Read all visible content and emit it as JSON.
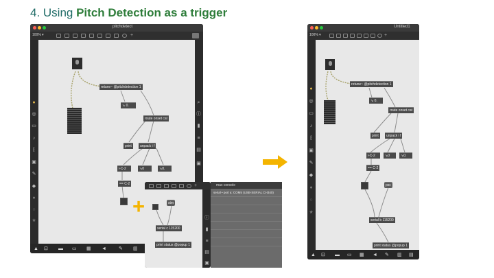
{
  "slide": {
    "title_prefix": "4. Using ",
    "title_bold": "Pitch Detection as a trigger"
  },
  "colors": {
    "title": "#1f6b66",
    "arrow": "#f4b400",
    "plus": "#f4b400",
    "patch_cable": "#a8a26a"
  },
  "window_left": {
    "title": "pitchdetect",
    "zoom": "100% ▾",
    "objects": {
      "retune": "retune~ @pitchdetection 1",
      "float_out": "↘ 0.",
      "route": "route onset cat",
      "print": "print",
      "unpack": "unpack i f",
      "note_name": "i-C-2",
      "num_a": "↘0",
      "num_b": "↘0.",
      "eq": "== C-2"
    },
    "icons": [
      "lock-icon",
      "presentation-icon",
      "grid-icon",
      "patcher-icon",
      "speaker-icon",
      "wrench-icon",
      "piano-icon"
    ]
  },
  "window_small": {
    "objects": {
      "msg": "stm",
      "serial": "serial c 115200",
      "print_status": "print status @popup 1"
    }
  },
  "console": {
    "title": "max console",
    "lines": [
      "serial • port a: COM5 (USB-SERIAL CH340)"
    ]
  },
  "window_right": {
    "title": "Untitled1",
    "zoom": "100% ▾",
    "objects": {
      "retune": "retune~ @pitchdetection 1",
      "float_out": "↘ 0.",
      "route": "route onset cat",
      "print": "print",
      "unpack": "unpack i f",
      "note_name": "i-C-2",
      "num_a": "↘0",
      "num_b": "↘0.",
      "eq": "== C-2",
      "msg": "psc",
      "serial": "serial b 115200",
      "print_status": "print status @popup 1"
    }
  }
}
